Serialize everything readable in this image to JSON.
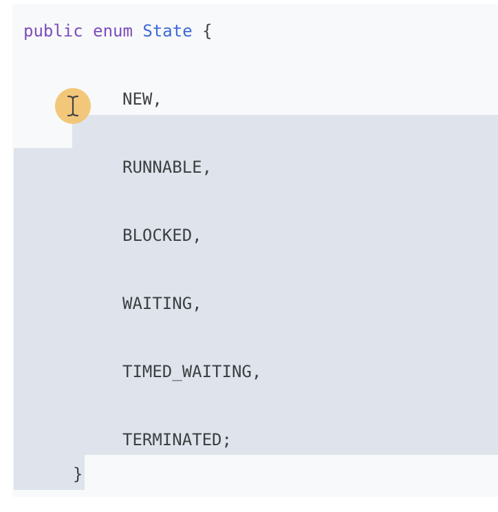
{
  "code": {
    "keyword_public": "public",
    "keyword_enum": "enum",
    "type_name": "State",
    "open_brace": "{",
    "items": [
      "NEW,",
      "RUNNABLE,",
      "BLOCKED,",
      "WAITING,",
      "TIMED_WAITING,",
      "TERMINATED;"
    ],
    "close_brace": "}"
  },
  "colors": {
    "background": "#f8f9fa",
    "selection": "#dfe4ec",
    "keyword": "#7c4dba",
    "type": "#3d6ad6",
    "text": "#3c4043",
    "cursor_highlight": "#f2c574"
  },
  "icons": {
    "cursor": "text-cursor-icon"
  }
}
